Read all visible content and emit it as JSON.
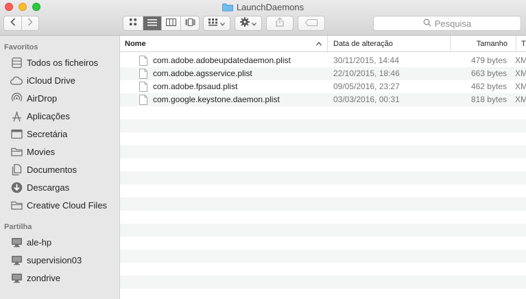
{
  "window": {
    "title": "LaunchDaemons"
  },
  "toolbar": {
    "back_icon": "chevron-left-icon",
    "forward_icon": "chevron-right-icon",
    "views": [
      "icon-view-icon",
      "list-view-icon",
      "column-view-icon",
      "cover-flow-icon"
    ],
    "active_view": "list",
    "search_placeholder": "Pesquisa"
  },
  "sidebar": {
    "favorites_title": "Favoritos",
    "favorites": [
      {
        "label": "Todos os ficheiros",
        "icon": "all-files-icon"
      },
      {
        "label": "iCloud Drive",
        "icon": "cloud-icon"
      },
      {
        "label": "AirDrop",
        "icon": "airdrop-icon"
      },
      {
        "label": "Aplicações",
        "icon": "applications-icon"
      },
      {
        "label": "Secretária",
        "icon": "desktop-icon"
      },
      {
        "label": "Movies",
        "icon": "folder-icon"
      },
      {
        "label": "Documentos",
        "icon": "documents-icon"
      },
      {
        "label": "Descargas",
        "icon": "downloads-icon"
      },
      {
        "label": "Creative Cloud Files",
        "icon": "folder-icon"
      }
    ],
    "shared_title": "Partilha",
    "shared": [
      {
        "label": "ale-hp",
        "icon": "computer-icon"
      },
      {
        "label": "supervision03",
        "icon": "computer-icon"
      },
      {
        "label": "zondrive",
        "icon": "computer-icon"
      }
    ]
  },
  "table": {
    "columns": {
      "name": "Nome",
      "date": "Data de alteração",
      "size": "Tamanho",
      "kind": "Tipo"
    },
    "rows": [
      {
        "name": "com.adobe.adobeupdatedaemon.plist",
        "date": "30/11/2015, 14:44",
        "size": "479 bytes",
        "kind": "XML"
      },
      {
        "name": "com.adobe.agsservice.plist",
        "date": "22/10/2015, 18:46",
        "size": "663 bytes",
        "kind": "XML"
      },
      {
        "name": "com.adobe.fpsaud.plist",
        "date": "09/05/2016, 23:27",
        "size": "462 bytes",
        "kind": "XML"
      },
      {
        "name": "com.google.keystone.daemon.plist",
        "date": "03/03/2016, 00:31",
        "size": "818 bytes",
        "kind": "XML"
      }
    ]
  },
  "colors": {
    "list_view_active": "#6b6b6b",
    "alt_row": "#f4f5f5",
    "folder_blue": "#5fb3ec"
  }
}
